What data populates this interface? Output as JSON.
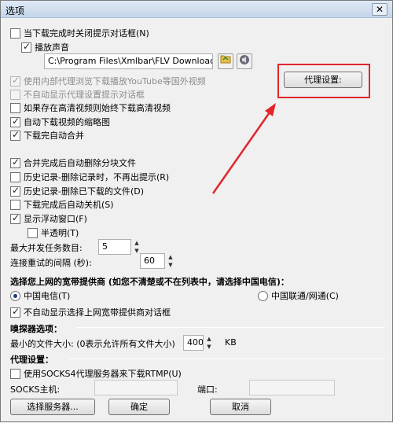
{
  "window": {
    "title": "选项",
    "close_glyph": "✕"
  },
  "general": {
    "close_prompt": "当下载完成时关闭提示对话框(N)",
    "play_sound": "播放声音",
    "sound_path": "C:\\Program Files\\Xmlbar\\FLV Downloader\\sounds",
    "use_proxy_youtube": "使用内部代理浏览下载播放YouTube等国外视频",
    "no_proxy_prompt": "不自动显示代理设置提示对话框",
    "hd_download": "如果存在高清视频则始终下载高清视频",
    "auto_thumbnail": "自动下载视频的缩略图",
    "auto_merge": "下载完自动合并",
    "delete_chunks": "合并完成后自动删除分块文件",
    "history_no_prompt": "历史记录-删除记录时，不再出提示(R)",
    "history_delete_files": "历史记录-删除已下载的文件(D)",
    "auto_shutdown": "下载完成后自动关机(S)",
    "floating_window": "显示浮动窗口(F)",
    "translucent": "半透明(T)",
    "max_tasks_label": "最大并发任务数目:",
    "max_tasks_value": "5",
    "retry_label": "连接重试的间隔 (秒):",
    "retry_value": "60"
  },
  "proxy_button": "代理设置:",
  "isp": {
    "heading": "选择您上网的宽带提供商 (如您不清楚或不在列表中，请选择中国电信)：",
    "option_telecom": "中国电信(T)",
    "option_unicom": "中国联通/网通(C)",
    "no_prompt": "不自动显示选择上网宽带提供商对话框"
  },
  "sniffer": {
    "heading": "嗅探器选项：",
    "min_size_label": "最小的文件大小: (0表示允许所有文件大小)",
    "min_size_value": "400",
    "unit": "KB"
  },
  "proxy": {
    "heading": "代理设置：",
    "socks4": "使用SOCKS4代理服务器来下载RTMP(U)",
    "host_label": "SOCKS主机:",
    "port_label": "端口:"
  },
  "buttons": {
    "select_server": "选择服务器...",
    "ok": "确定",
    "cancel": "取消"
  },
  "colors": {
    "annotation_red": "#e0262c"
  }
}
